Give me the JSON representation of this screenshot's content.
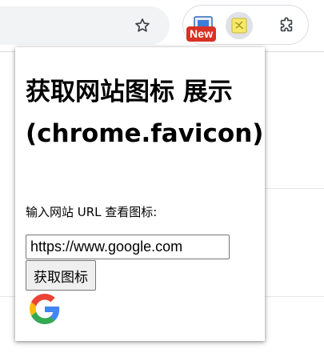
{
  "toolbar": {
    "new_badge": "New",
    "icons": [
      "star-icon",
      "extension-icon-a",
      "favicon-extension-icon",
      "puzzle-extensions-icon"
    ]
  },
  "popup": {
    "title": "获取网站图标 展示 (chrome.favicon)",
    "url_label": "输入网站 URL 查看图标:",
    "url_value": "https://www.google.com",
    "button_label": "获取图标",
    "favicon": "google-g-icon"
  },
  "colors": {
    "badge_red": "#d93025",
    "google_blue": "#4285F4",
    "google_red": "#EA4335",
    "google_yellow": "#FBBC05",
    "google_green": "#34A853"
  }
}
